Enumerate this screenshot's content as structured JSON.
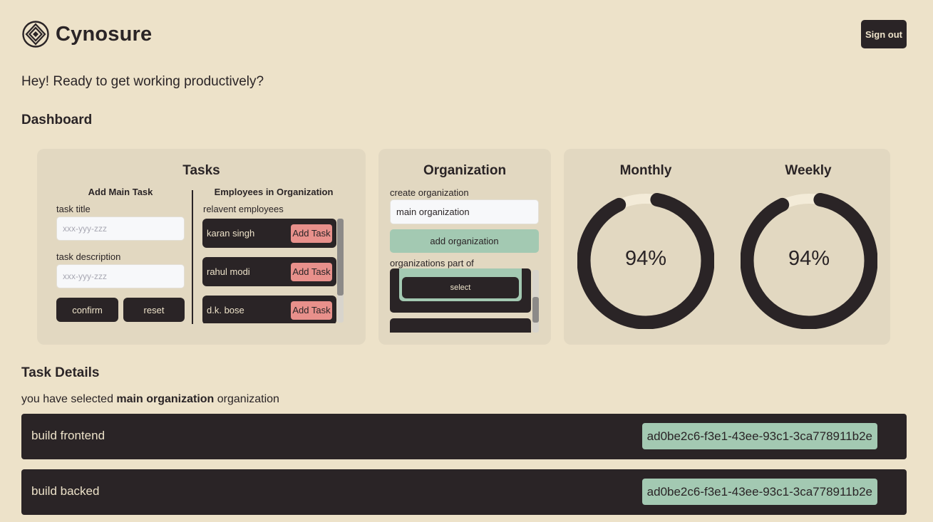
{
  "brand": {
    "name": "Cynosure",
    "logo_icon": "layered-diamond-logo"
  },
  "header": {
    "signout_label": "Sign out"
  },
  "greeting": "Hey! Ready to get working productively?",
  "dashboard": {
    "title": "Dashboard",
    "tasks_card": {
      "title": "Tasks",
      "add_main_task": {
        "heading": "Add Main Task",
        "task_title_label": "task title",
        "task_title_placeholder": "xxx-yyy-zzz",
        "task_description_label": "task description",
        "task_description_placeholder": "xxx-yyy-zzz",
        "confirm_label": "confirm",
        "reset_label": "reset"
      },
      "employees": {
        "heading": "Employees in Organization",
        "subheading": "relavent employees",
        "add_task_label": "Add Task",
        "items": [
          {
            "name": "karan singh"
          },
          {
            "name": "rahul modi"
          },
          {
            "name": "d.k. bose"
          }
        ]
      }
    },
    "organization_card": {
      "title": "Organization",
      "create_label": "create organization",
      "create_value": "main organization",
      "add_button_label": "add organization",
      "part_of_label": "organizations part of",
      "select_label": "select"
    },
    "stats_card": {
      "monthly": {
        "title": "Monthly",
        "value_text": "94%",
        "value": 0.94
      },
      "weekly": {
        "title": "Weekly",
        "value_text": "94%",
        "value": 0.94
      }
    }
  },
  "task_details": {
    "title": "Task Details",
    "selected_prefix": "you have selected ",
    "selected_org": "main organization",
    "selected_suffix": " organization",
    "tasks": [
      {
        "title": "build frontend",
        "id": "ad0be2c6-f3e1-43ee-93c1-3ca778911b2e"
      },
      {
        "title": "build backed",
        "id": "ad0be2c6-f3e1-43ee-93c1-3ca778911b2e"
      }
    ]
  },
  "colors": {
    "background": "#ede2c9",
    "card": "#e2d8c1",
    "dark": "#2a2426",
    "accent_green": "#a3c9b2",
    "accent_red": "#e8908b"
  }
}
